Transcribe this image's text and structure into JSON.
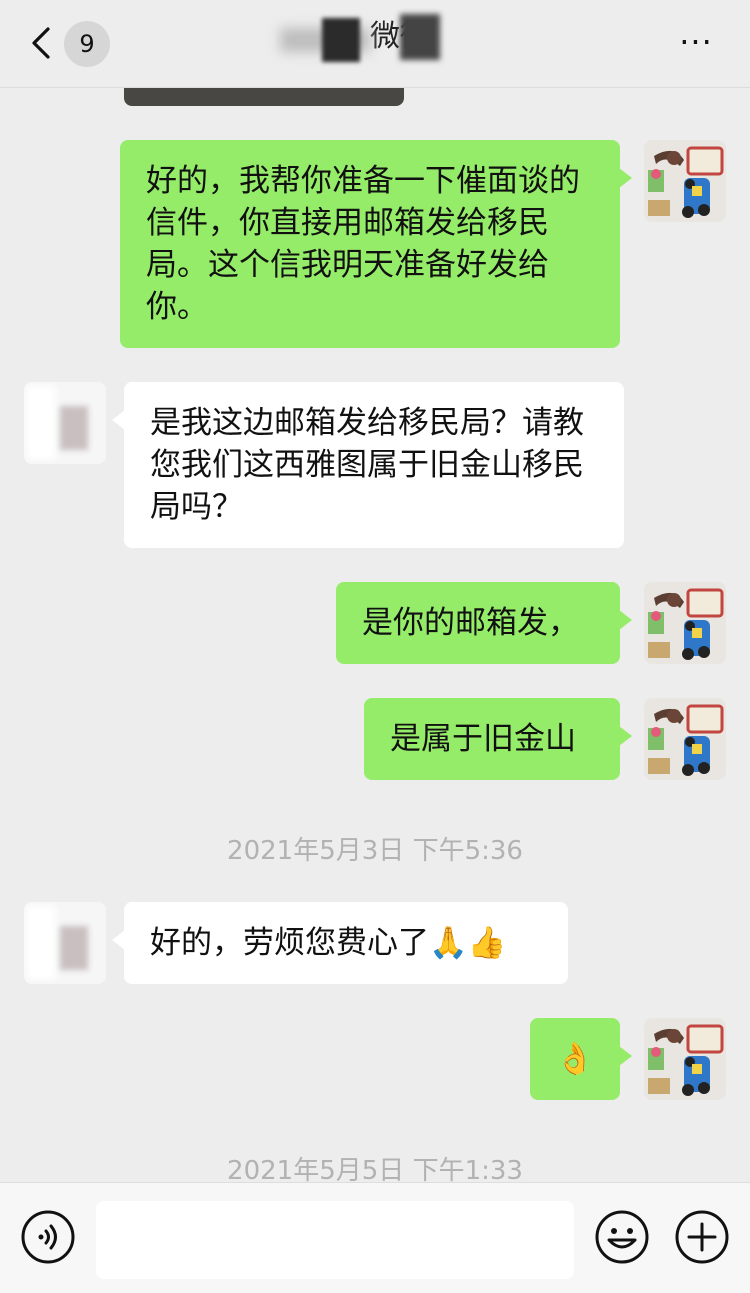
{
  "header": {
    "back_badge": "9",
    "title": "微微",
    "more_label": "···"
  },
  "messages": [
    {
      "sender": "me",
      "text": "好的，我帮你准备一下催面谈的信件，你直接用邮箱发给移民局。这个信我明天准备好发给你。"
    },
    {
      "sender": "contact",
      "text": "是我这边邮箱发给移民局？请教您我们这西雅图属于旧金山移民局吗？"
    },
    {
      "sender": "me",
      "text": "是你的邮箱发，"
    },
    {
      "sender": "me",
      "text": "是属于旧金山"
    },
    {
      "type": "timestamp",
      "text": "2021年5月3日 下午5:36"
    },
    {
      "sender": "contact",
      "text": "好的，劳烦您费心了🙏👍"
    },
    {
      "sender": "me",
      "text": "👌"
    },
    {
      "type": "timestamp",
      "text": "2021年5月5日 下午1:33"
    }
  ],
  "input_bar": {
    "voice_icon": "voice-icon",
    "emoji_icon": "emoji-icon",
    "plus_icon": "plus-icon",
    "text_value": ""
  },
  "colors": {
    "mine_bubble": "#95ec69",
    "theirs_bubble": "#ffffff",
    "background": "#ededed"
  }
}
